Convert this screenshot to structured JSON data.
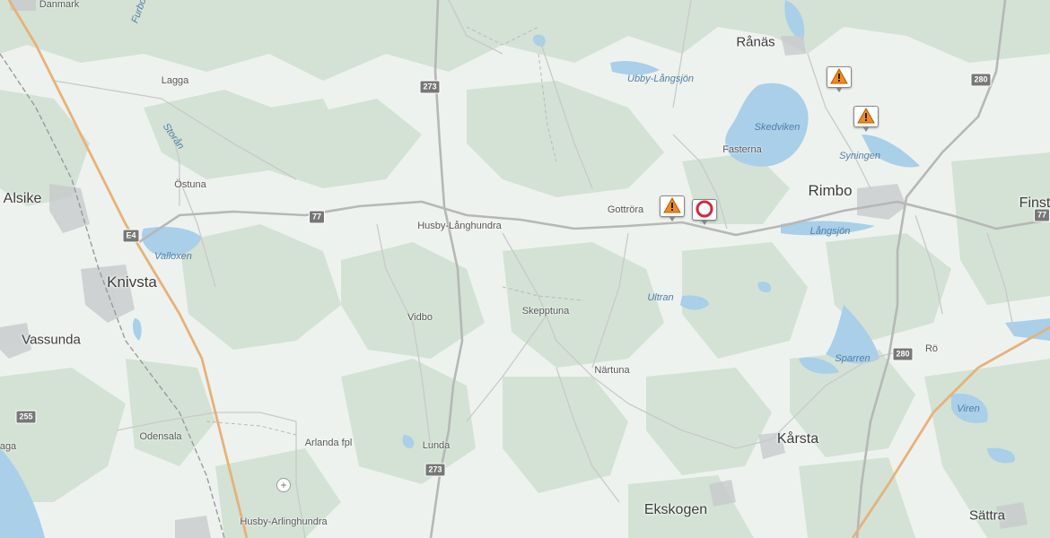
{
  "places": {
    "danmark": "Danmark",
    "furbo": "Furbo",
    "lagga": "Lagga",
    "ostuna": "Östuna",
    "alsike": "Alsike",
    "knivsta": "Knivsta",
    "vassunda": "Vassunda",
    "odensala": "Odensala",
    "arlanda_fpl": "Arlanda fpl",
    "husby_arlinghundra": "Husby-Arlinghundra",
    "husby_langhundra": "Husby-Långhundra",
    "vidbo": "Vidbo",
    "lunda": "Lunda",
    "skepptuna": "Skepptuna",
    "nartuna": "Närtuna",
    "gottrora": "Gottröra",
    "ekskogen": "Ekskogen",
    "karsta": "Kårsta",
    "ranas": "Rånäs",
    "fasterna": "Fasterna",
    "rimbo": "Rimbo",
    "finst": "Finst",
    "ro": "Rö",
    "sattra": "Sättra",
    "aga": "aga"
  },
  "water": {
    "storan": "Storån",
    "valloxen": "Valloxen",
    "ubby_langsjon": "Ubby-Långsjön",
    "skedviken": "Skedviken",
    "syningen": "Syningen",
    "langsjon": "Långsjön",
    "ultran": "Ultran",
    "sparren": "Sparren",
    "viren": "Viren"
  },
  "roads": {
    "e4": "E4",
    "r77a": "77",
    "r77b": "77",
    "r273a": "273",
    "r273b": "273",
    "r280a": "280",
    "r280b": "280",
    "r255": "255"
  },
  "markers": [
    {
      "type": "roadwork",
      "label": "roadwork-warning"
    },
    {
      "type": "roadwork",
      "label": "roadwork-warning"
    },
    {
      "type": "roadwork",
      "label": "roadwork-warning"
    },
    {
      "type": "no-entry",
      "label": "no-vehicles"
    }
  ],
  "colors": {
    "land": "#eef2ee",
    "forest": "#d3e2d4",
    "water": "#a9cfe9",
    "road_major": "#e6b27a",
    "road_secondary": "#b7b7b7",
    "road_minor": "#c9c9c9",
    "warning": "#f08a1c",
    "no_entry": "#d7263d"
  }
}
